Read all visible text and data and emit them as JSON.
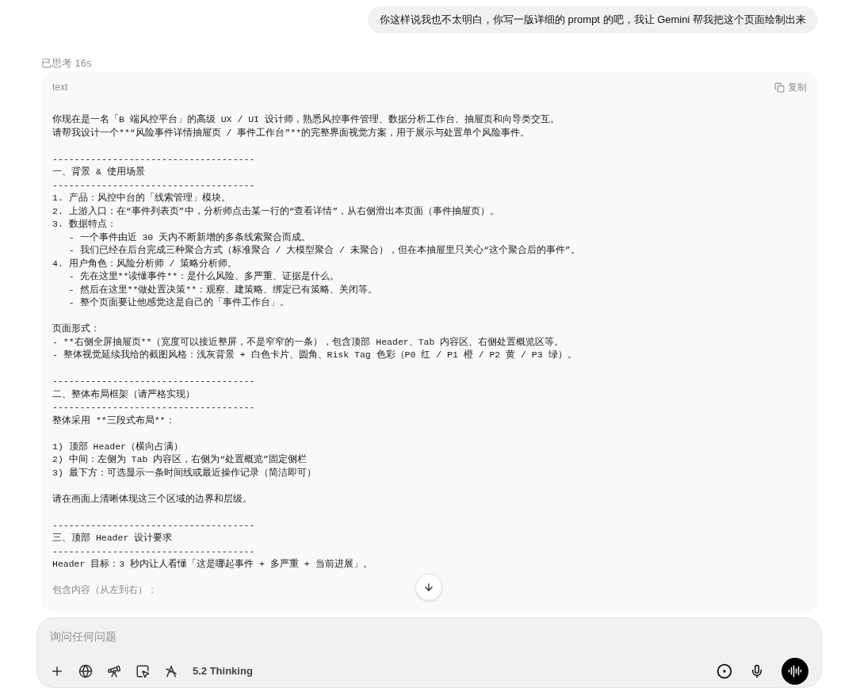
{
  "user_message": "你这样说我也不太明白，你写一版详细的 prompt 的吧，我让 Gemini 帮我把这个页面绘制出来",
  "thought_label": "已思考 16s",
  "code_block": {
    "language": "text",
    "copy_label": "复制",
    "blocks": [
      [
        "你现在是一名「B 端风控平台」的高级 UX / UI 设计师，熟悉风控事件管理、数据分析工作台、抽屉页和向导类交互。",
        "请帮我设计一个**“风险事件详情抽屉页 / 事件工作台”**的完整界面视觉方案，用于展示与处置单个风险事件。"
      ],
      [
        "-------------------------------------",
        "一、背景 & 使用场景",
        "-------------------------------------",
        "1. 产品：风控中台的「线索管理」模块。",
        "2. 上游入口：在“事件列表页”中，分析师点击某一行的“查看详情”，从右侧滑出本页面（事件抽屉页）。",
        "3. 数据特点：",
        "   - 一个事件由近 30 天内不断新增的多条线索聚合而成。",
        "   - 我们已经在后台完成三种聚合方式（标准聚合 / 大模型聚合 / 未聚合），但在本抽屉里只关心“这个聚合后的事件”。",
        "4. 用户角色：风险分析师 / 策略分析师。",
        "   - 先在这里**读懂事件**：是什么风险、多严重、证据是什么。",
        "   - 然后在这里**做处置决策**：观察、建策略、绑定已有策略、关闭等。",
        "   - 整个页面要让他感觉这是自己的「事件工作台」。"
      ],
      [
        "页面形式：",
        "- **右侧全屏抽屉页**（宽度可以接近整屏，不是窄窄的一条），包含顶部 Header、Tab 内容区、右侧处置概览区等。",
        "- 整体视觉延续我给的截图风格：浅灰背景 + 白色卡片、圆角、Risk Tag 色彩（P0 红 / P1 橙 / P2 黄 / P3 绿）。"
      ],
      [
        "-------------------------------------",
        "二、整体布局框架（请严格实现）",
        "-------------------------------------",
        "整体采用 **三段式布局**："
      ],
      [
        "1) 顶部 Header（横向占满）",
        "2) 中间：左侧为 Tab 内容区，右侧为“处置概览”固定侧栏",
        "3) 最下方：可选显示一条时间线或最近操作记录（简洁即可）"
      ],
      [
        "请在画面上清晰体现这三个区域的边界和层级。"
      ],
      [
        "-------------------------------------",
        "三、顶部 Header 设计要求",
        "-------------------------------------",
        "Header 目标：3 秒内让人看懂「这是哪起事件 + 多严重 + 当前进展」。"
      ],
      [
        "包含内容（从左到右）："
      ]
    ]
  },
  "composer": {
    "placeholder": "询问任何问题",
    "model_label": "5.2 Thinking"
  }
}
